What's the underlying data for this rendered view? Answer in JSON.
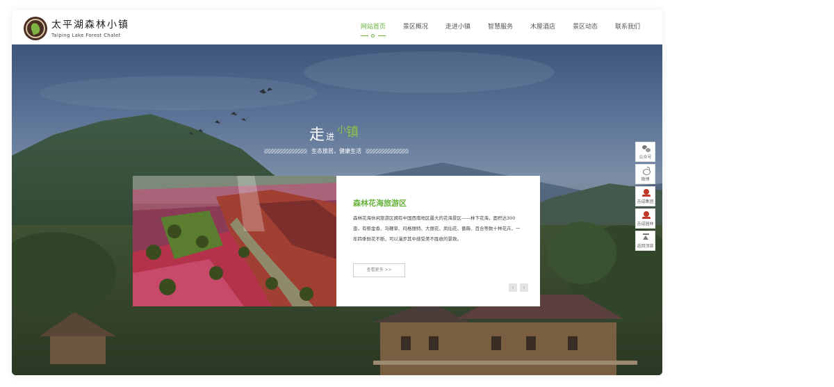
{
  "brand": {
    "name_cn": "太平湖森林小镇",
    "name_en": "Taiping Lake Forest Chalet"
  },
  "nav": {
    "items": [
      {
        "label": "网站首页",
        "active": true
      },
      {
        "label": "景区概况",
        "active": false
      },
      {
        "label": "走进小镇",
        "active": false
      },
      {
        "label": "智慧服务",
        "active": false
      },
      {
        "label": "木屋酒店",
        "active": false
      },
      {
        "label": "景区动态",
        "active": false
      },
      {
        "label": "联系我们",
        "active": false
      }
    ]
  },
  "hero": {
    "title_part1": "走",
    "title_part2": "进",
    "title_part3": "小",
    "title_part4": "镇",
    "slogan": "生态旅居，健康生活"
  },
  "card": {
    "title": "森林花海旅游区",
    "description": "森林花海休闲旅游区拥有中国西南地区最大的花海景区——林下花海，面积达300亩，有郁金香、马鞭草、玛格丽特、大丽花、凤仙花、蔷薇、百合等数十种花卉，一年四季鲜花不断，可以漫步其中感受美不胜收的景致。",
    "more_label": "查看更多 >>",
    "prev_label": "‹",
    "next_label": "›"
  },
  "float_bar": {
    "items": [
      {
        "label": "公众号",
        "icon": "wechat-icon"
      },
      {
        "label": "微博",
        "icon": "weibo-icon"
      },
      {
        "label": "吉成集团",
        "icon": "group-logo-icon"
      },
      {
        "label": "吉成园林",
        "icon": "garden-logo-icon"
      },
      {
        "label": "返回顶部",
        "icon": "back-to-top-icon"
      }
    ]
  },
  "colors": {
    "accent": "#67b23a",
    "title_green": "#8bc34a"
  }
}
